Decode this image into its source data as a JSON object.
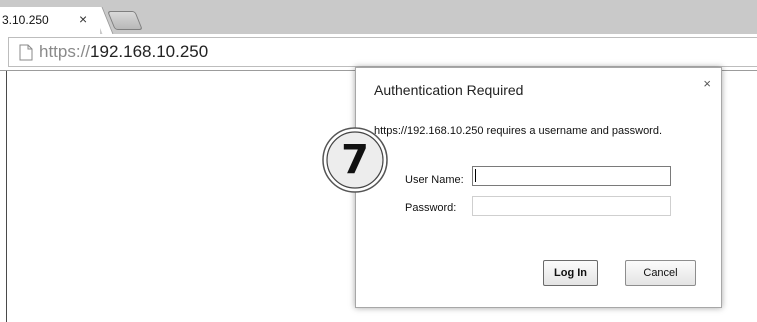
{
  "tab": {
    "title": "3.10.250",
    "close_glyph": "×"
  },
  "address_bar": {
    "scheme": "https://",
    "host": "192.168.10.250",
    "icon": "page-icon"
  },
  "dialog": {
    "title": "Authentication Required",
    "close_glyph": "×",
    "message": "https://192.168.10.250 requires a username and password.",
    "username_label": "User Name:",
    "username_value": "",
    "password_label": "Password:",
    "password_value": "",
    "login_label": "Log In",
    "cancel_label": "Cancel"
  },
  "step_badge": {
    "number": "7"
  }
}
